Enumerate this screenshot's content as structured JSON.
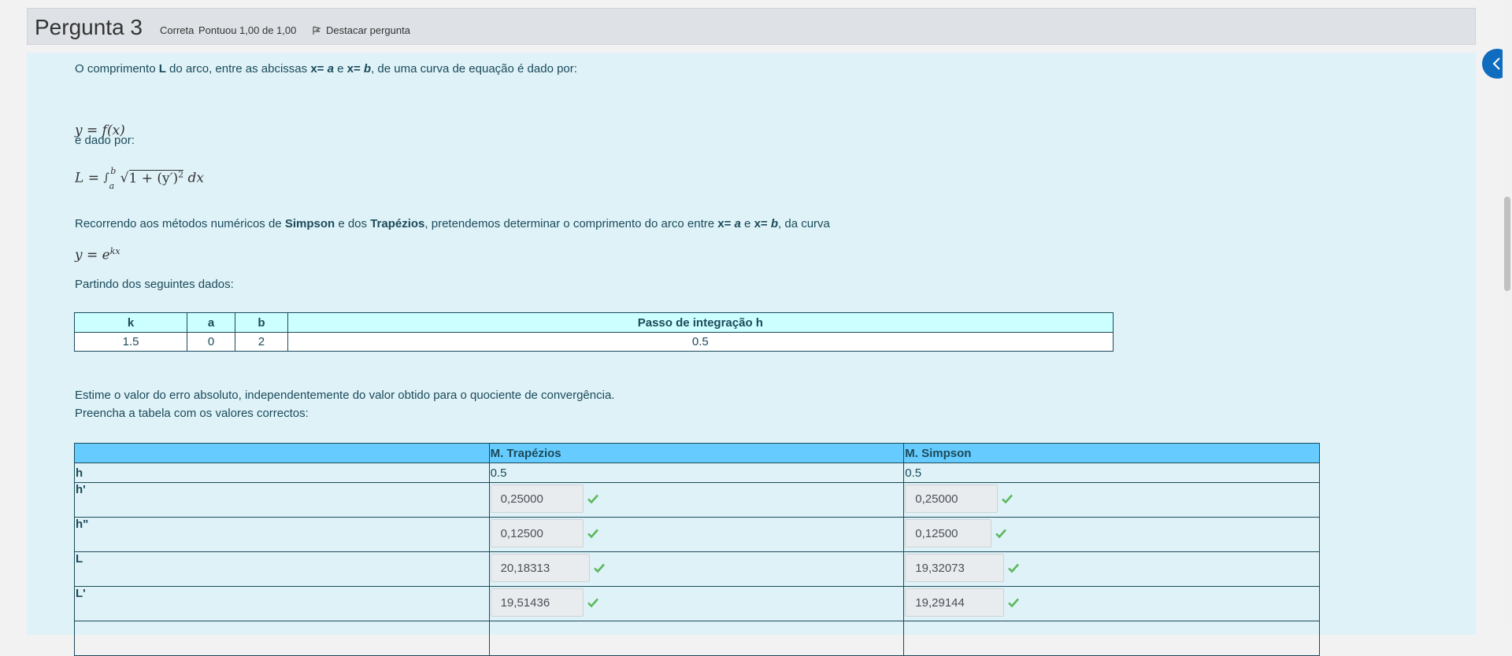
{
  "header": {
    "title_word": "Pergunta",
    "title_number": "3",
    "status": "Correta",
    "score": "Pontuou 1,00 de 1,00",
    "flag_label": "Destacar pergunta"
  },
  "content": {
    "intro": {
      "p1": "O comprimento ",
      "L": "L",
      "p2": " do arco, entre as abcissas ",
      "xa_pre": "x= ",
      "xa_var": "a",
      "p3": " e ",
      "xb_pre": "x= ",
      "xb_var": "b",
      "p4": ", de uma curva de equação é dado por:"
    },
    "eq1": "y = f(x)",
    "e_dado_por": "é dado por:",
    "eq2": {
      "lhs": "L = ",
      "integral": "∫",
      "upper": "b",
      "lower": "a",
      "sqrt": "√",
      "radicand": "1 + (y′)",
      "power": "2",
      "dx": " dx"
    },
    "recorrendo": {
      "p1": "Recorrendo aos métodos numéricos de ",
      "simpson": "Simpson",
      "p2": " e dos ",
      "trapezios": "Trapézios",
      "p3": ", pretendemos determinar o comprimento do arco entre ",
      "xa_pre": "x= ",
      "xa_var": "a",
      "p4": " e ",
      "xb_pre": "x= ",
      "xb_var": "b",
      "p5": ", da curva"
    },
    "eq3": {
      "base": "y = e",
      "exp": "kx"
    },
    "partindo": "Partindo dos seguintes dados:",
    "data_table": {
      "headers": [
        "k",
        "a",
        "b",
        "Passo de integração h"
      ],
      "row": [
        "1.5",
        "0",
        "2",
        "0.5"
      ]
    },
    "estime": "Estime o valor do erro absoluto, independentemente do valor obtido para o quociente de convergência.",
    "preencha": "Preencha a tabela com os valores correctos:",
    "answer_table": {
      "headers": [
        "",
        "M. Trapézios",
        "M. Simpson"
      ],
      "h_row": {
        "label": "h",
        "trap": "0.5",
        "simp": "0.5"
      },
      "rows": [
        {
          "label": "h'",
          "trap": "0,25000",
          "simp": "0,25000"
        },
        {
          "label": "h\"",
          "trap": "0,12500",
          "simp": "0,12500"
        },
        {
          "label": "L",
          "trap": "20,18313",
          "simp": "19,32073"
        },
        {
          "label": "L'",
          "trap": "19,51436",
          "simp": "19,29144"
        }
      ]
    }
  },
  "colors": {
    "content_bg": "#def2f8",
    "check_green": "#5cb85c",
    "accent_blue": "#0f6cbf"
  }
}
